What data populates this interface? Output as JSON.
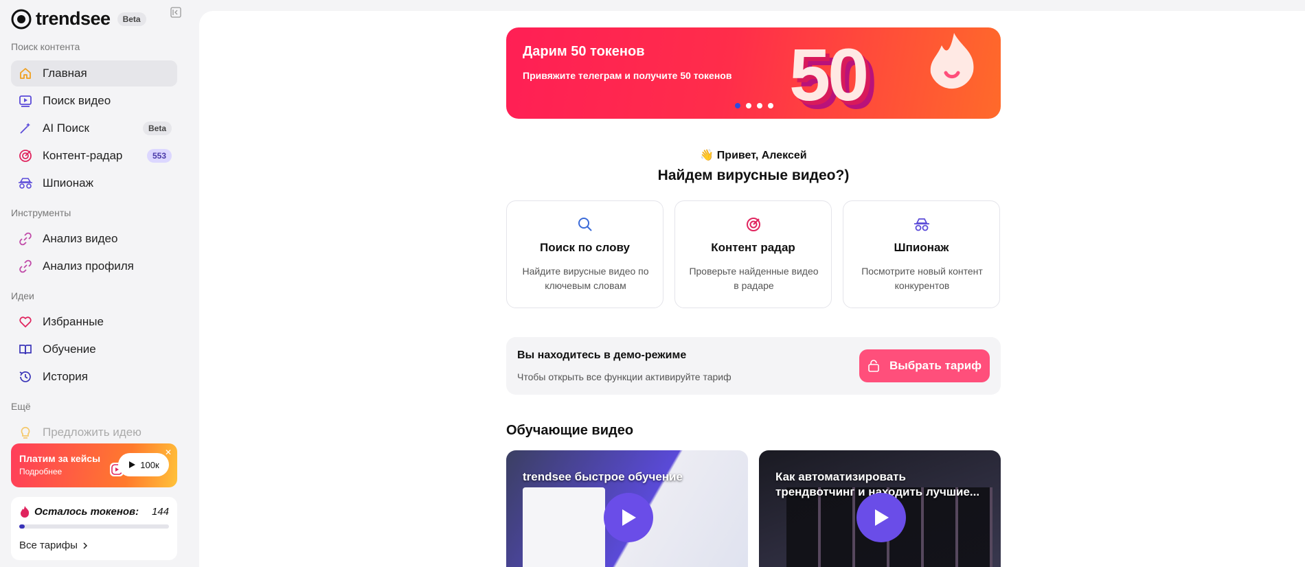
{
  "sidebar": {
    "logo": "trendsee",
    "logo_badge": "Beta",
    "sections": {
      "search": "Поиск контента",
      "tools": "Инструменты",
      "ideas": "Идеи",
      "more": "Ещё"
    },
    "items": [
      {
        "label": "Главная",
        "icon": "home-icon"
      },
      {
        "label": "Поиск видео",
        "icon": "video-search-icon"
      },
      {
        "label": "AI Поиск",
        "icon": "magic-wand-icon",
        "badge": "Beta"
      },
      {
        "label": "Контент-радар",
        "icon": "target-icon",
        "badge": "553"
      },
      {
        "label": "Шпионаж",
        "icon": "spy-icon"
      },
      {
        "label": "Анализ видео",
        "icon": "link-icon"
      },
      {
        "label": "Анализ профиля",
        "icon": "link-icon"
      },
      {
        "label": "Избранные",
        "icon": "heart-icon"
      },
      {
        "label": "Обучение",
        "icon": "book-icon"
      },
      {
        "label": "История",
        "icon": "history-icon"
      },
      {
        "label": "Предложить идею",
        "icon": "bulb-icon"
      }
    ],
    "promo": {
      "title": "Платим за кейсы",
      "subtitle": "Подробнее",
      "pill": "100к"
    },
    "tokens": {
      "label": "Осталось токенов:",
      "count": "144",
      "fraction": 0.02,
      "link": "Все тарифы"
    }
  },
  "main": {
    "banner": {
      "title": "Дарим 50 токенов",
      "subtitle": "Привяжите телеграм и получите 50 токенов",
      "big_number": "50",
      "slides": 4,
      "active_slide": 1
    },
    "greeting": "👋 Привет, Алексей",
    "headline": "Найдем вирусные видео?)",
    "features": [
      {
        "title": "Поиск по слову",
        "desc": "Найдите вирусные видео по ключевым словам",
        "icon": "search-icon"
      },
      {
        "title": "Контент радар",
        "desc": "Проверьте найденные видео в радаре",
        "icon": "target-icon"
      },
      {
        "title": "Шпионаж",
        "desc": "Посмотрите новый контент конкурентов",
        "icon": "spy-icon"
      }
    ],
    "demo": {
      "title": "Вы находитесь в демо-режиме",
      "subtitle": "Чтобы открыть все функции активируйте тариф",
      "button": "Выбрать тариф"
    },
    "videos_title": "Обучающие видео",
    "videos": [
      {
        "caption": "trendsee быстрое обучение"
      },
      {
        "caption": "Как автоматизировать трендвотчинг и находить лучшие..."
      }
    ]
  },
  "colors": {
    "accent_pink": "#ff4f7b",
    "banner_red": "#ff1f55",
    "brand_purple": "#6a4de8",
    "sidebar_bg": "#f4f4f6"
  }
}
